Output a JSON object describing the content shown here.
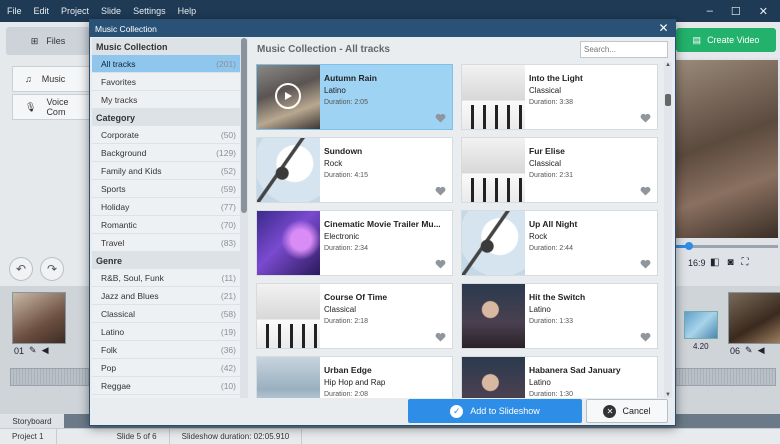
{
  "app": {
    "menu": [
      "File",
      "Edit",
      "Project",
      "Slide",
      "Settings",
      "Help"
    ],
    "files_tab": "Files",
    "create_video": "Create Video",
    "side_tabs": [
      "Music",
      "Voice Com"
    ],
    "aspect_ratio": "16:9",
    "clip_left_num": "01",
    "clip_right_num": "06",
    "transition_duration": "4.20",
    "storyboard_tab": "Storyboard",
    "status": {
      "project": "Project 1",
      "slide": "Slide 5 of 6",
      "duration": "Slideshow duration: 02:05.910"
    }
  },
  "dialog": {
    "title": "Music Collection",
    "panel_title": "Music Collection - All tracks",
    "search_placeholder": "Search...",
    "add_label": "Add to Slideshow",
    "cancel_label": "Cancel",
    "sections": [
      {
        "header": "Music Collection",
        "items": [
          {
            "label": "All tracks",
            "count": "(201)",
            "selected": true
          },
          {
            "label": "Favorites",
            "count": ""
          },
          {
            "label": "My tracks",
            "count": ""
          }
        ]
      },
      {
        "header": "Category",
        "items": [
          {
            "label": "Corporate",
            "count": "(50)"
          },
          {
            "label": "Background",
            "count": "(129)"
          },
          {
            "label": "Family and Kids",
            "count": "(52)"
          },
          {
            "label": "Sports",
            "count": "(59)"
          },
          {
            "label": "Holiday",
            "count": "(77)"
          },
          {
            "label": "Romantic",
            "count": "(70)"
          },
          {
            "label": "Travel",
            "count": "(83)"
          }
        ]
      },
      {
        "header": "Genre",
        "items": [
          {
            "label": "R&B, Soul, Funk",
            "count": "(11)"
          },
          {
            "label": "Jazz and Blues",
            "count": "(21)"
          },
          {
            "label": "Classical",
            "count": "(58)"
          },
          {
            "label": "Latino",
            "count": "(19)"
          },
          {
            "label": "Folk",
            "count": "(36)"
          },
          {
            "label": "Pop",
            "count": "(42)"
          },
          {
            "label": "Reggae",
            "count": "(10)"
          }
        ]
      }
    ],
    "tracks": [
      {
        "title": "Autumn Rain",
        "genre": "Latino",
        "duration": "Duration: 2:05",
        "thumb": "autumn",
        "selected": true
      },
      {
        "title": "Into the Light",
        "genre": "Classical",
        "duration": "Duration: 3:38",
        "thumb": "piano"
      },
      {
        "title": "Sundown",
        "genre": "Rock",
        "duration": "Duration: 4:15",
        "thumb": "guitar"
      },
      {
        "title": "Fur Elise",
        "genre": "Classical",
        "duration": "Duration: 2:31",
        "thumb": "piano"
      },
      {
        "title": "Cinematic Movie Trailer Mu...",
        "genre": "Electronic",
        "duration": "Duration: 2:34",
        "thumb": "cinema"
      },
      {
        "title": "Up All Night",
        "genre": "Rock",
        "duration": "Duration: 2:44",
        "thumb": "guitar"
      },
      {
        "title": "Course Of Time",
        "genre": "Classical",
        "duration": "Duration: 2:18",
        "thumb": "piano"
      },
      {
        "title": "Hit the Switch",
        "genre": "Latino",
        "duration": "Duration: 1:33",
        "thumb": "dancers"
      },
      {
        "title": "Urban Edge",
        "genre": "Hip Hop and Rap",
        "duration": "Duration: 2:08",
        "thumb": "urban"
      },
      {
        "title": "Habanera Sad January",
        "genre": "Latino",
        "duration": "Duration: 1:30",
        "thumb": "dancers"
      }
    ]
  }
}
